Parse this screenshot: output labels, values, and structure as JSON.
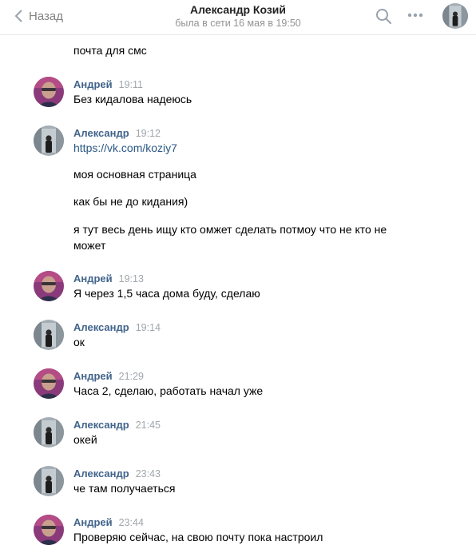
{
  "header": {
    "back_label": "Назад",
    "title": "Александр Козий",
    "status": "была в сети 16 мая в 19:50"
  },
  "messages": [
    {
      "text": "почта для смс"
    },
    {
      "author": "Андрей",
      "time": "19:11",
      "text": "Без кидалова надеюсь"
    },
    {
      "author": "Александр",
      "time": "19:12",
      "link": "https://vk.com/koziy7"
    },
    {
      "text": "моя основная страница"
    },
    {
      "text": "как бы не до кидания)"
    },
    {
      "text": "я тут весь день ищу кто омжет сделать потмоу что не кто не может"
    },
    {
      "author": "Андрей",
      "time": "19:13",
      "text": "Я через 1,5 часа дома буду, сделаю"
    },
    {
      "author": "Александр",
      "time": "19:14",
      "text": "ок"
    },
    {
      "author": "Андрей",
      "time": "21:29",
      "text": "Часа 2, сделаю, работать начал уже"
    },
    {
      "author": "Александр",
      "time": "21:45",
      "text": "окей"
    },
    {
      "author": "Александр",
      "time": "23:43",
      "text": "че там получаеться"
    },
    {
      "author": "Андрей",
      "time": "23:44",
      "text": "Проверяю сейчас, на свою почту пока настроил"
    }
  ],
  "colors": {
    "author": "#42648b",
    "link": "#2a5885",
    "time": "#a0a6ab",
    "header_icon": "#99a2ad"
  },
  "icons": [
    "chevron-left-icon",
    "search-icon",
    "more-dots-icon"
  ]
}
